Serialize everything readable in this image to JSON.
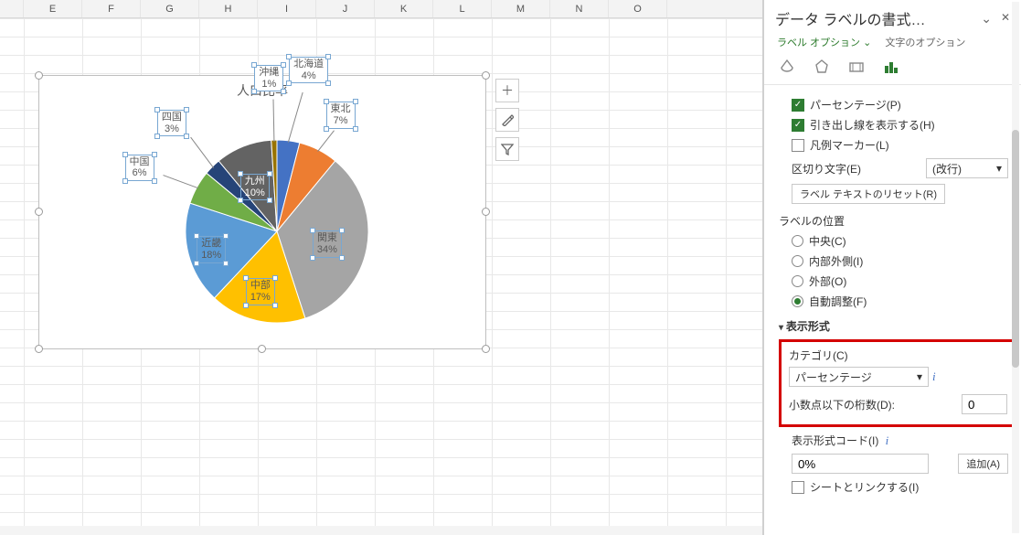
{
  "columns": [
    "E",
    "F",
    "G",
    "H",
    "I",
    "J",
    "K",
    "L",
    "M",
    "N",
    "O"
  ],
  "chart_data": {
    "type": "pie",
    "title": "人口比率",
    "categories": [
      "北海道",
      "東北",
      "関東",
      "中部",
      "近畿",
      "中国",
      "四国",
      "九州",
      "沖縄"
    ],
    "values": [
      4,
      7,
      34,
      17,
      18,
      6,
      3,
      10,
      1
    ],
    "labels_pct": [
      "4%",
      "7%",
      "34%",
      "17%",
      "18%",
      "6%",
      "3%",
      "10%",
      "1%"
    ],
    "colors": [
      "#4472c4",
      "#ed7d31",
      "#a5a5a5",
      "#ffc000",
      "#5b9bd5",
      "#70ad47",
      "#264478",
      "#636363",
      "#997300"
    ]
  },
  "side_buttons": {
    "plus": "＋",
    "brush": "brush",
    "filter": "filter"
  },
  "pane": {
    "title": "データ ラベルの書式…",
    "tabs": {
      "label_opt": "ラベル オプション",
      "text_opt": "文字のオプション"
    },
    "checks": {
      "percentage": "パーセンテージ(P)",
      "percentage_checked": true,
      "leader": "引き出し線を表示する(H)",
      "leader_checked": true,
      "legend_marker": "凡例マーカー(L)",
      "legend_marker_checked": false
    },
    "separator": {
      "label": "区切り文字(E)",
      "value": "(改行)"
    },
    "reset_btn": "ラベル テキストのリセット(R)",
    "position": {
      "heading": "ラベルの位置",
      "center": "中央(C)",
      "inside_end": "内部外側(I)",
      "outside": "外部(O)",
      "best_fit": "自動調整(F)",
      "selected": "best_fit"
    },
    "format": {
      "heading": "表示形式",
      "category_label": "カテゴリ(C)",
      "category_value": "パーセンテージ",
      "decimals_label": "小数点以下の桁数(D):",
      "decimals_value": "0",
      "code_label": "表示形式コード(I)",
      "code_value": "0%",
      "add_btn": "追加(A)",
      "link_src": "シートとリンクする(I)",
      "link_src_checked": false
    }
  }
}
